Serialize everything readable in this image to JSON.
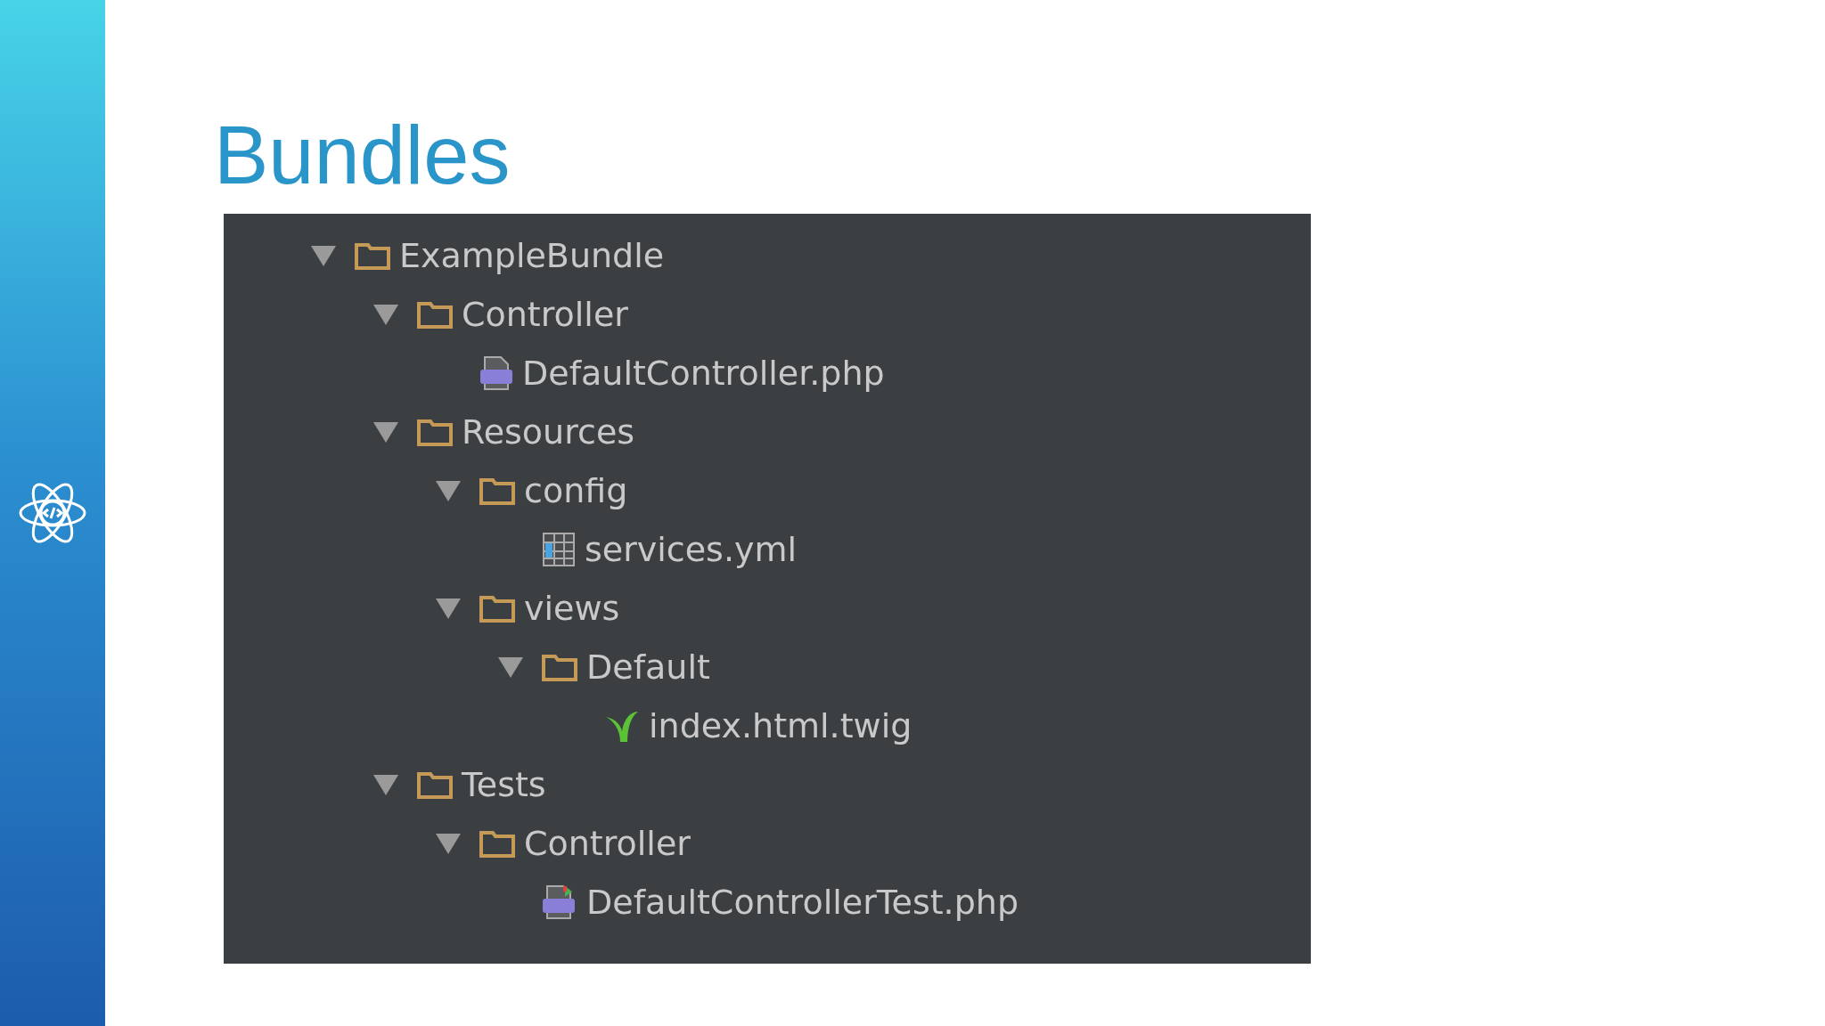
{
  "title": "Bundles",
  "tree": [
    {
      "label": "ExampleBundle",
      "kind": "folder",
      "expanded": true,
      "children": [
        {
          "label": "Controller",
          "kind": "folder",
          "expanded": true,
          "children": [
            {
              "label": "DefaultController.php",
              "kind": "php"
            }
          ]
        },
        {
          "label": "Resources",
          "kind": "folder",
          "expanded": true,
          "children": [
            {
              "label": "config",
              "kind": "folder",
              "expanded": true,
              "children": [
                {
                  "label": "services.yml",
                  "kind": "yml"
                }
              ]
            },
            {
              "label": "views",
              "kind": "folder",
              "expanded": true,
              "children": [
                {
                  "label": "Default",
                  "kind": "folder",
                  "expanded": true,
                  "children": [
                    {
                      "label": "index.html.twig",
                      "kind": "twig"
                    }
                  ]
                }
              ]
            }
          ]
        },
        {
          "label": "Tests",
          "kind": "folder",
          "expanded": true,
          "children": [
            {
              "label": "Controller",
              "kind": "folder",
              "expanded": true,
              "children": [
                {
                  "label": "DefaultControllerTest.php",
                  "kind": "phptest"
                }
              ]
            }
          ]
        }
      ]
    }
  ]
}
